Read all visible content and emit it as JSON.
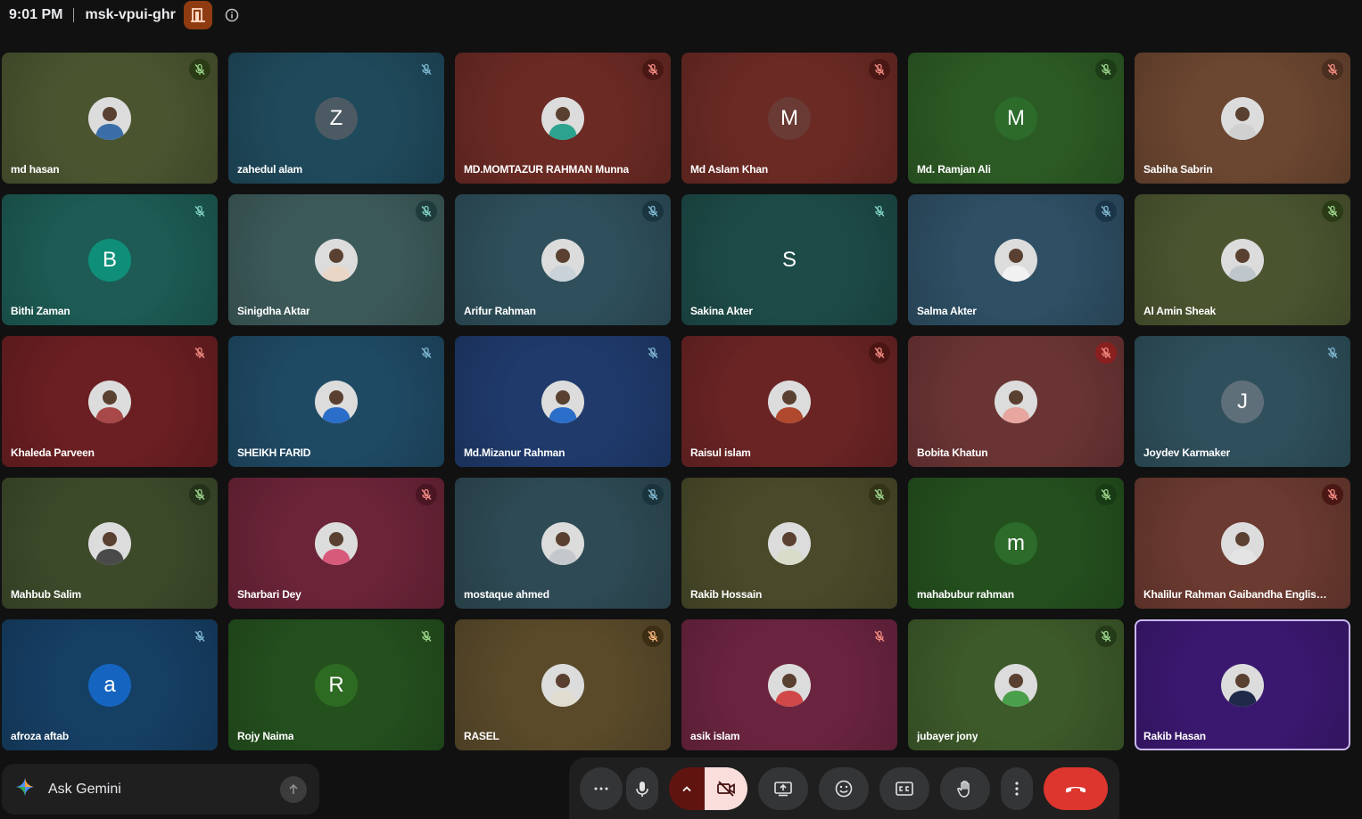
{
  "meeting": {
    "time": "9:01 PM",
    "code": "msk-vpui-ghr"
  },
  "participants": [
    {
      "name": "md hasan",
      "initial": "",
      "photo": true,
      "photo_color": "#3b6ea8",
      "bg": "#4a5530",
      "mic_bg": "#2a3b16",
      "mic_color": "#9ad38a"
    },
    {
      "name": "zahedul alam",
      "initial": "Z",
      "photo": false,
      "avatar_color": "#4b5a63",
      "bg": "#1f4a5c",
      "mic_bg": "transparent",
      "mic_color": "#7fb7d1"
    },
    {
      "name": "MD.MOMTAZUR RAHMAN Munna",
      "initial": "",
      "photo": true,
      "photo_color": "#2ca38f",
      "bg": "#6b2a24",
      "mic_bg": "#4a1814",
      "mic_color": "#f28b82"
    },
    {
      "name": "Md Aslam Khan",
      "initial": "M",
      "photo": false,
      "avatar_color": "#6a3a34",
      "bg": "#6b2a24",
      "mic_bg": "#4a1814",
      "mic_color": "#f28b82"
    },
    {
      "name": "Md. Ramjan Ali",
      "initial": "M",
      "photo": false,
      "avatar_color": "#2c6b2a",
      "bg": "#2c5a24",
      "mic_bg": "#1d3d18",
      "mic_color": "#9ad38a"
    },
    {
      "name": "Sabiha Sabrin",
      "initial": "",
      "photo": true,
      "photo_color": "#d0d0d0",
      "bg": "#6b4630",
      "mic_bg": "#4a2e1f",
      "mic_color": "#f28b82"
    },
    {
      "name": "Bithi Zaman",
      "initial": "B",
      "photo": false,
      "avatar_color": "#0f8f7a",
      "bg": "#1d5b54",
      "mic_bg": "transparent",
      "mic_color": "#7fd1c4"
    },
    {
      "name": "Sinigdha Aktar",
      "initial": "",
      "photo": true,
      "photo_color": "#e9d6c6",
      "bg": "#3d5a5a",
      "mic_bg": "#1f3b3b",
      "mic_color": "#7fd1c4"
    },
    {
      "name": "Arifur Rahman",
      "initial": "",
      "photo": true,
      "photo_color": "#c8d2d8",
      "bg": "#2e4f5b",
      "mic_bg": "#1b3540",
      "mic_color": "#7fb7d1"
    },
    {
      "name": "Sakina Akter",
      "initial": "S",
      "photo": false,
      "avatar_color": "#1d4b48",
      "bg": "#1d4b48",
      "mic_bg": "transparent",
      "mic_color": "#7fd1c4"
    },
    {
      "name": "Salma Akter",
      "initial": "",
      "photo": true,
      "photo_color": "#f1f1f1",
      "bg": "#2e4f64",
      "mic_bg": "#1b3548",
      "mic_color": "#7fb7d1"
    },
    {
      "name": "Al Amin Sheak",
      "initial": "",
      "photo": true,
      "photo_color": "#bfc7cc",
      "bg": "#4a5530",
      "mic_bg": "#2a3b16",
      "mic_color": "#9ad38a"
    },
    {
      "name": "Khaleda Parveen",
      "initial": "",
      "photo": true,
      "photo_color": "#a84848",
      "bg": "#6b1f22",
      "mic_bg": "transparent",
      "mic_color": "#f28b82"
    },
    {
      "name": "SHEIKH FARID",
      "initial": "",
      "photo": true,
      "photo_color": "#2b6ec9",
      "bg": "#1f4a64",
      "mic_bg": "transparent",
      "mic_color": "#7fb7d1"
    },
    {
      "name": "Md.Mizanur Rahman",
      "initial": "",
      "photo": true,
      "photo_color": "#2b6ec9",
      "bg": "#1f3a6b",
      "mic_bg": "transparent",
      "mic_color": "#7fb7d1"
    },
    {
      "name": "Raisul islam",
      "initial": "",
      "photo": true,
      "photo_color": "#b0482e",
      "bg": "#6b2424",
      "mic_bg": "#4a1614",
      "mic_color": "#f28b82"
    },
    {
      "name": "Bobita Khatun",
      "initial": "",
      "photo": true,
      "photo_color": "#e8a6a0",
      "bg": "#6b3434",
      "mic_bg": "#8a1f1f",
      "mic_color": "#f28b82"
    },
    {
      "name": "Joydev Karmaker",
      "initial": "J",
      "photo": false,
      "avatar_color": "#5f6f7a",
      "bg": "#2e4f5b",
      "mic_bg": "transparent",
      "mic_color": "#7fb7d1"
    },
    {
      "name": "Mahbub Salim",
      "initial": "",
      "photo": true,
      "photo_color": "#4a4a4a",
      "bg": "#3d4a2a",
      "mic_bg": "#24321a",
      "mic_color": "#9ad38a"
    },
    {
      "name": "Sharbari Dey",
      "initial": "",
      "photo": true,
      "photo_color": "#d85a7a",
      "bg": "#6b2438",
      "mic_bg": "#4a1624",
      "mic_color": "#f28b82"
    },
    {
      "name": "mostaque ahmed",
      "initial": "",
      "photo": true,
      "photo_color": "#c4c8cc",
      "bg": "#2e4a54",
      "mic_bg": "#1b333b",
      "mic_color": "#7fb7d1"
    },
    {
      "name": "Rakib Hossain",
      "initial": "",
      "photo": true,
      "photo_color": "#d8dcc8",
      "bg": "#4a4a2a",
      "mic_bg": "#333318",
      "mic_color": "#9ad38a"
    },
    {
      "name": "mahabubur rahman",
      "initial": "m",
      "photo": false,
      "avatar_color": "#2c6b2a",
      "bg": "#24501e",
      "mic_bg": "#183a14",
      "mic_color": "#9ad38a"
    },
    {
      "name": "Khalilur Rahman Gaibandha English...",
      "initial": "",
      "photo": true,
      "photo_color": "#e4e4e4",
      "bg": "#6b3a30",
      "mic_bg": "#4a1814",
      "mic_color": "#f28b82"
    },
    {
      "name": "afroza aftab",
      "initial": "a",
      "photo": false,
      "avatar_color": "#1565c0",
      "bg": "#163f64",
      "mic_bg": "transparent",
      "mic_color": "#7fb7d1"
    },
    {
      "name": "Rojy Naima",
      "initial": "R",
      "photo": false,
      "avatar_color": "#2e6b22",
      "bg": "#24501e",
      "mic_bg": "transparent",
      "mic_color": "#9ad38a"
    },
    {
      "name": "RASEL",
      "initial": "",
      "photo": true,
      "photo_color": "#e0dcd0",
      "bg": "#5a4a2a",
      "mic_bg": "#3b2e14",
      "mic_color": "#f2b27a"
    },
    {
      "name": "asik islam",
      "initial": "",
      "photo": true,
      "photo_color": "#d04848",
      "bg": "#6b2440",
      "mic_bg": "transparent",
      "mic_color": "#f28b82"
    },
    {
      "name": "jubayer jony",
      "initial": "",
      "photo": true,
      "photo_color": "#4aa04a",
      "bg": "#3d5a2a",
      "mic_bg": "#243a18",
      "mic_color": "#9ad38a"
    },
    {
      "name": "Rakib Hasan",
      "initial": "",
      "photo": true,
      "photo_color": "#1f2a4a",
      "bg": "#3b1870",
      "mic_bg": "none",
      "mic_color": "none",
      "self": true
    }
  ],
  "gemini": {
    "label": "Ask Gemini"
  },
  "colors": {
    "hangup": "#dc362e",
    "camera_off": "#f9dedc",
    "self_outline": "#c9b8f0"
  },
  "icons": [
    "host-badge-icon",
    "info-icon",
    "mic-off-icon",
    "person-photo-icon",
    "gemini-sparkle-icon",
    "send-arrow-icon",
    "more-options-icon",
    "microphone-icon",
    "chevron-up-icon",
    "camera-off-icon",
    "present-screen-icon",
    "emoji-icon",
    "captions-icon",
    "raise-hand-icon",
    "vertical-dots-icon",
    "hang-up-icon"
  ]
}
